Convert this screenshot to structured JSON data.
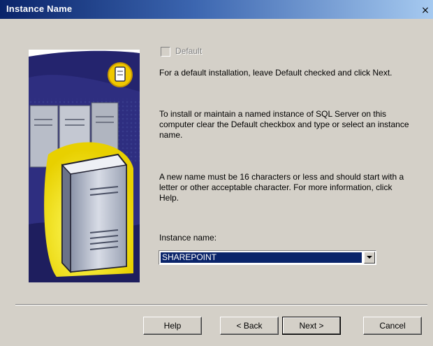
{
  "window": {
    "title": "Instance Name",
    "close_glyph": "×"
  },
  "default_checkbox": {
    "label": "Default",
    "checked": false,
    "enabled": false
  },
  "paragraphs": [
    "For a default installation, leave Default checked and click Next.",
    "To install or maintain a named instance of SQL Server on this computer clear the Default checkbox and type or select an instance name.",
    "A new name must be 16 characters or less and should start with a letter or other acceptable character.  For more information, click Help."
  ],
  "instance": {
    "label": "Instance name:",
    "value": "SHAREPOINT"
  },
  "buttons": {
    "help": "Help",
    "back": "< Back",
    "next": "Next >",
    "cancel": "Cancel"
  },
  "illustration": {
    "icon": "server-tower-illustration",
    "badge_icon": "database-icon"
  }
}
